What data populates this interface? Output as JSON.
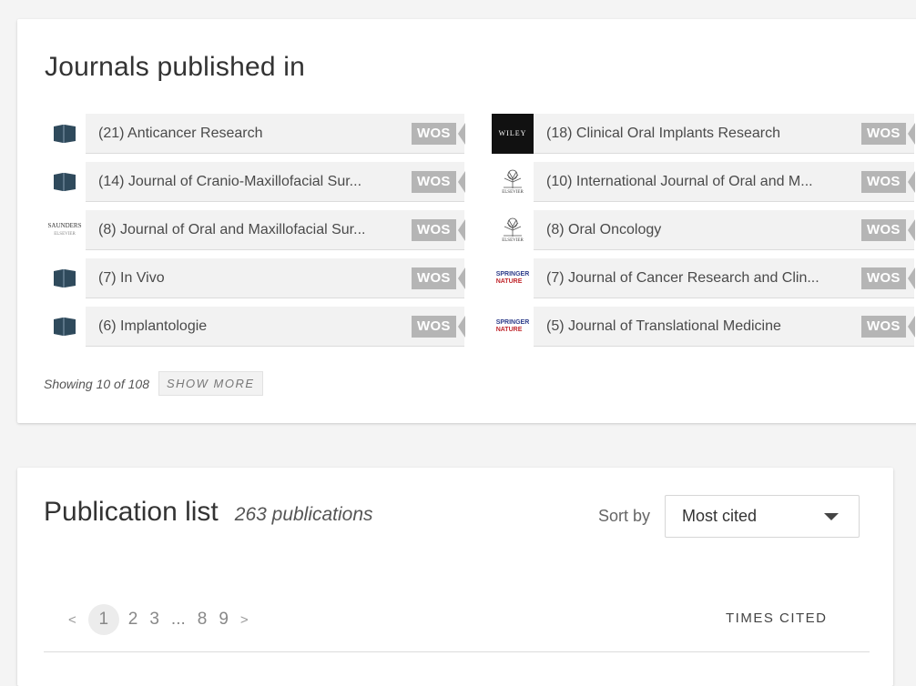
{
  "journals_card": {
    "title": "Journals published in",
    "journals": [
      {
        "name": "(21) Anticancer Research",
        "logo": "generic-book",
        "badge": "WOS"
      },
      {
        "name": "(18) Clinical Oral Implants Research",
        "logo": "wiley",
        "logo_text": "WILEY",
        "badge": "WOS"
      },
      {
        "name": "(14) Journal of Cranio-Maxillofacial Sur...",
        "logo": "generic-book",
        "badge": "WOS"
      },
      {
        "name": "(10) International Journal of Oral and M...",
        "logo": "elsevier",
        "logo_text": "ELSEVIER",
        "badge": "WOS"
      },
      {
        "name": "(8) Journal of Oral and Maxillofacial Sur...",
        "logo": "saunders",
        "logo_text": "SAUNDERS",
        "logo_subtext": "ELSEVIER",
        "badge": "WOS"
      },
      {
        "name": "(8) Oral Oncology",
        "logo": "elsevier",
        "logo_text": "ELSEVIER",
        "badge": "WOS"
      },
      {
        "name": "(7) In Vivo",
        "logo": "generic-book",
        "badge": "WOS"
      },
      {
        "name": "(7) Journal of Cancer Research and Clin...",
        "logo": "springer-nature",
        "logo_text": "SPRINGER",
        "logo_subtext": "NATURE",
        "badge": "WOS"
      },
      {
        "name": "(6) Implantologie",
        "logo": "generic-book",
        "badge": "WOS"
      },
      {
        "name": "(5) Journal of Translational Medicine",
        "logo": "springer-nature",
        "logo_text": "SPRINGER",
        "logo_subtext": "NATURE",
        "badge": "WOS"
      }
    ],
    "showing_text": "Showing 10 of 108",
    "show_more_label": "SHOW MORE"
  },
  "publications_card": {
    "title": "Publication list",
    "count": "263 publications",
    "sort_label": "Sort by",
    "sort_value": "Most cited",
    "pagination": {
      "prev": "<",
      "pages": [
        "1",
        "2",
        "3",
        "...",
        "8",
        "9"
      ],
      "current": "1",
      "next": ">"
    },
    "times_cited_label": "TIMES CITED"
  },
  "colors": {
    "badge_bg": "#b5b5b5",
    "row_bg": "#f2f2f2",
    "page_bg": "#f4f4f4",
    "springer_blue": "#2d3c8a",
    "nature_red": "#c0282d",
    "book_icon": "#2f4a5c"
  }
}
